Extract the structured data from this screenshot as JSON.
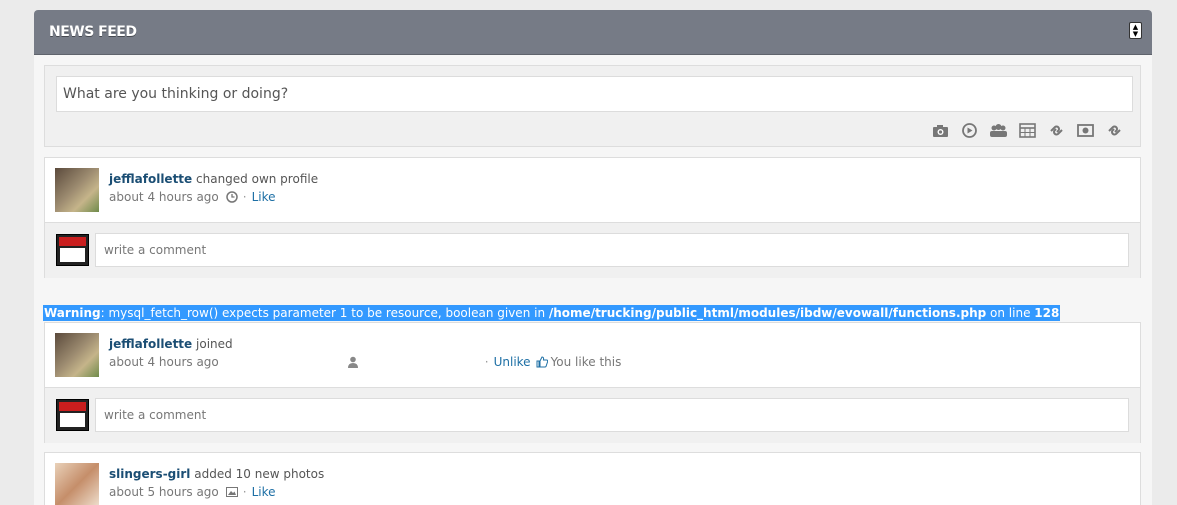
{
  "panel": {
    "title": "News Feed"
  },
  "composer": {
    "placeholder": "What are you thinking or doing?",
    "icons": [
      "camera-icon",
      "video-icon",
      "group-icon",
      "calendar-icon",
      "link-icon",
      "money-icon",
      "link-icon-2"
    ]
  },
  "posts": [
    {
      "user": "jefflafollette",
      "action": "changed own profile",
      "time": "about 4 hours ago",
      "like_label": "Like",
      "comment_placeholder": "write a comment"
    },
    {
      "user": "jefflafollette",
      "action": "joined",
      "time": "about 4 hours ago",
      "unlike_label": "Unlike",
      "you_like": "You like this",
      "comment_placeholder": "write a comment"
    },
    {
      "user": "slingers-girl",
      "action": "added 10 new photos",
      "time": "about 5 hours ago",
      "like_label": "Like"
    }
  ],
  "warning": {
    "label": "Warning",
    "message": ": mysql_fetch_row() expects parameter 1 to be resource, boolean given in ",
    "path": "/home/trucking/public_html/modules/ibdw/evowall/functions.php",
    "line_text": " on line ",
    "line": "128"
  }
}
